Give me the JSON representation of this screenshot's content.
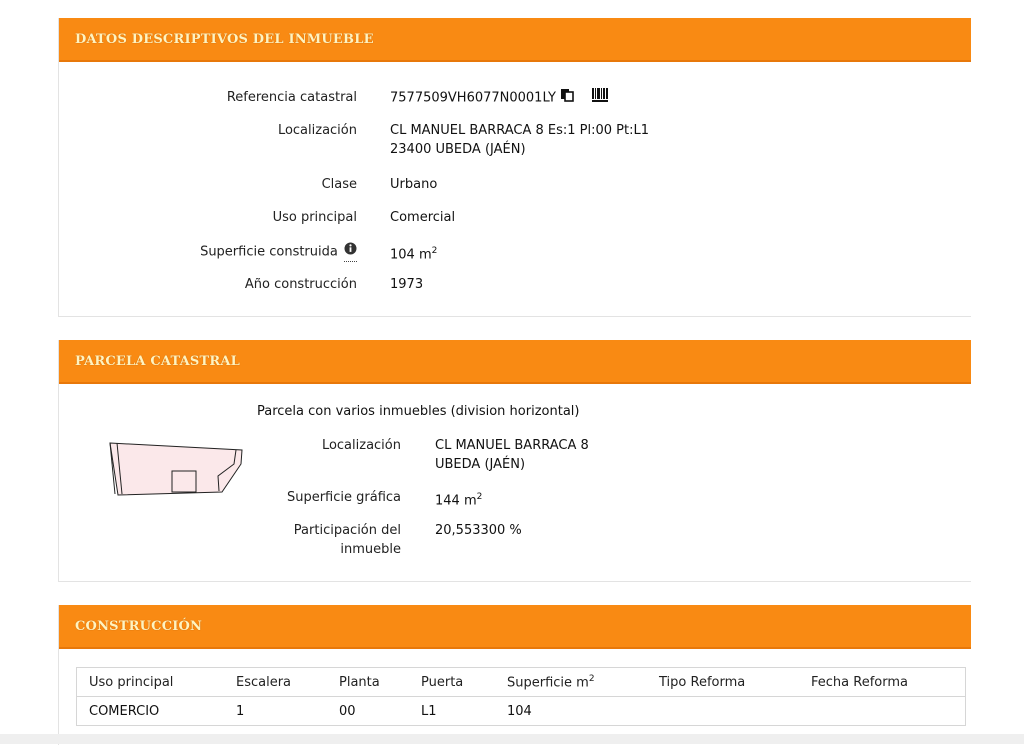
{
  "sections": {
    "datos": {
      "title": "DATOS DESCRIPTIVOS DEL INMUEBLE",
      "rows": [
        {
          "label": "Referencia catastral",
          "value": "7577509VH6077N0001LY"
        },
        {
          "label": "Localización",
          "value": "CL MANUEL BARRACA 8 Es:1 Pl:00 Pt:L1",
          "value2": "23400 UBEDA (JAÉN)"
        },
        {
          "label": "Clase",
          "value": "Urbano"
        },
        {
          "label": "Uso principal",
          "value": "Comercial"
        },
        {
          "label": "Superficie construida",
          "value": "104 m",
          "unit_sup": "2"
        },
        {
          "label": "Año construcción",
          "value": "1973"
        }
      ],
      "icons": [
        "copy-icon",
        "barcode-icon",
        "info-icon"
      ]
    },
    "parcela": {
      "title": "PARCELA CATASTRAL",
      "subtitle": "Parcela con varios inmuebles (division horizontal)",
      "rows": [
        {
          "label": "Localización",
          "value": "CL MANUEL BARRACA 8",
          "value2": "UBEDA (JAÉN)"
        },
        {
          "label": "Superficie gráfica",
          "value": "144 m",
          "unit_sup": "2"
        },
        {
          "label": "Participación del",
          "label2": "inmueble",
          "value": "20,553300 %"
        }
      ]
    },
    "construccion": {
      "title": "CONSTRUCCIÓN",
      "headers": [
        "Uso principal",
        "Escalera",
        "Planta",
        "Puerta",
        "Superficie m",
        "Tipo Reforma",
        "Fecha Reforma"
      ],
      "header_sup": "2",
      "rows": [
        [
          "COMERCIO",
          "1",
          "00",
          "L1",
          "104",
          "",
          ""
        ]
      ]
    }
  },
  "colors": {
    "header_orange": "#f98a13",
    "header_text": "#fff3c0",
    "parcel_fill": "#fbe8ea"
  }
}
